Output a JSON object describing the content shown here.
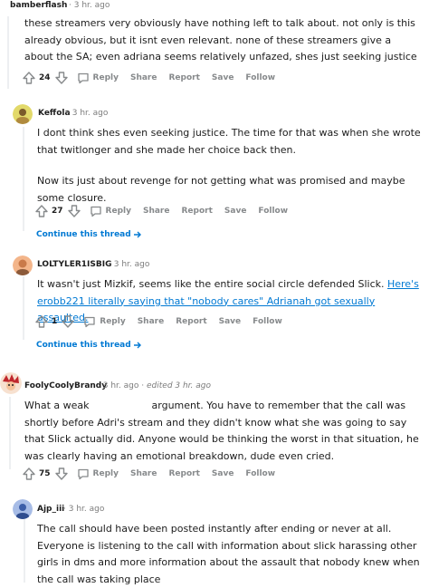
{
  "comments": [
    {
      "author": "bamberflash",
      "time": "3 hr. ago",
      "body": [
        "these streamers very obviously have nothing left to talk about. not only is this already obvious, but it isnt even relevant. none of these streamers give a about the SA; even adriana seems relatively unfazed, shes just seeking justice"
      ],
      "votes": "24"
    },
    {
      "author": "Keffola",
      "time": "3 hr. ago",
      "body": [
        "I dont think shes even seeking justice. The time for that was when she wrote that twitlonger and she made her choice back then.",
        "Now its just about revenge for not getting what was promised and maybe some closure."
      ],
      "votes": "27",
      "continue": "Continue this thread"
    },
    {
      "author": "LOLTYLER1ISBIG",
      "time": "3 hr. ago",
      "body_text": "It wasn't just Mizkif, seems like the entire social circle defended Slick. ",
      "body_link": "Here's erobb221 literally saying that \"nobody cares\" Adrianah got sexually assaulted.",
      "votes": "1",
      "continue": "Continue this thread"
    },
    {
      "author": "FoolyCoolyBrandy",
      "time": "3 hr. ago",
      "edited": "edited 3 hr. ago",
      "body_pre": "What a weak",
      "body_post": "argument. You have to remember that the call was shortly before Adri's stream and they didn't know what she was going to say that Slick actually did. Anyone would be thinking the worst in that situation, he was clearly having an emotional breakdown, dude even cried.",
      "votes": "75"
    },
    {
      "author": "Ajp_iii",
      "time": "3 hr. ago",
      "body": [
        "The call should have been posted instantly after ending or never at all. Everyone is listening to the call with information about slick harassing other girls in dms and more information about the assault that nobody knew when the call was taking place"
      ]
    }
  ],
  "actions": {
    "reply": "Reply",
    "share": "Share",
    "report": "Report",
    "save": "Save",
    "follow": "Follow"
  },
  "separator": "·",
  "colors": {
    "link": "#0079d3",
    "meta": "#7c7c7c",
    "action": "#878a8c",
    "thread_line": "#edeff1"
  },
  "icons": [
    "upvote-icon",
    "downvote-icon",
    "reply-bubble-icon",
    "continue-arrow-icon"
  ]
}
